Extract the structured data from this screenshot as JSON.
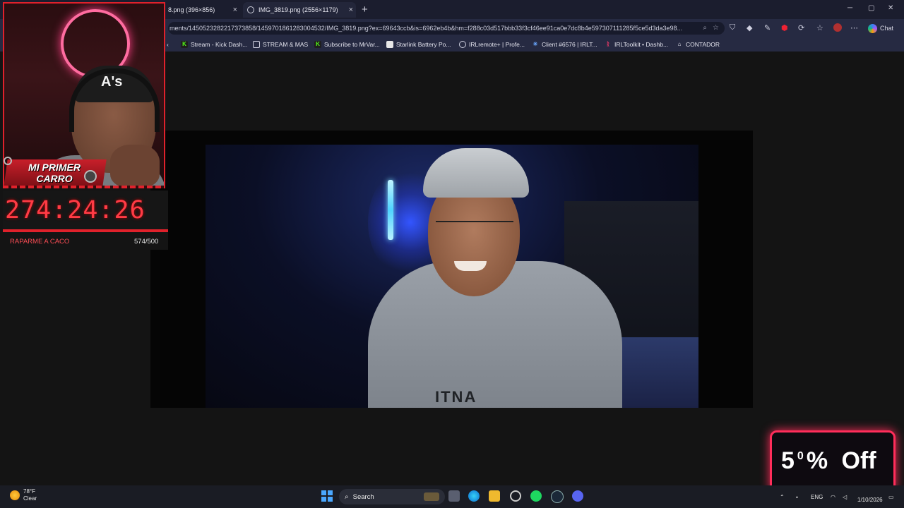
{
  "browser": {
    "tabs": [
      {
        "title": "8.png (396×856)",
        "active": false
      },
      {
        "title": "IMG_3819.png (2556×1179)",
        "active": true
      }
    ],
    "new_tab": "+",
    "close": "×",
    "window_controls": {
      "minimize": "─",
      "maximize": "▢",
      "close": "✕"
    },
    "url": "ments/1450523282217373858/1459701861283004532/IMG_3819.png?ex=69643ccb&is=6962eb4b&hm=f288c03d517bbb33f3cf46ee91ca0e7dc8b4e597307111285f5ce5d3da3e98...",
    "chat_label": "Chat",
    "bookmarks": [
      {
        "label": "Stream - Kick Dash...",
        "icon": "kick-icon"
      },
      {
        "label": "STREAM & MAS",
        "icon": "folder-icon"
      },
      {
        "label": "Subscribe to MrVar...",
        "icon": "kick-icon"
      },
      {
        "label": "Starlink Battery Po...",
        "icon": "page-icon"
      },
      {
        "label": "IRLremote+ | Profe...",
        "icon": "globe-icon"
      },
      {
        "label": "Client #6576 | IRLT...",
        "icon": "client-icon"
      },
      {
        "label": "IRLToolkit • Dashb...",
        "icon": "irltoolkit-icon"
      },
      {
        "label": "CONTADOR",
        "icon": "counter-icon"
      }
    ]
  },
  "image_viewer": {
    "shirt_text": "ITNA"
  },
  "overlay": {
    "webcam_badge": "MI PRIMER CARRO",
    "cap_logo": "A's",
    "timer": "274:24:26",
    "goal_label": "RAPARME A CACO",
    "goal_count": "574/500",
    "promo": {
      "digit": "5",
      "sup": "0",
      "percent": "%",
      "word": "Off"
    }
  },
  "taskbar": {
    "weather_temp": "78°F",
    "weather_desc": "Clear",
    "search_placeholder": "Search",
    "language": "ENG",
    "date": "1/10/2026"
  },
  "colors": {
    "accent_red": "#e0212b",
    "promo_border": "#ff2d5a",
    "browser_bg": "#262a42",
    "taskbar_bg": "#1a1c24"
  }
}
